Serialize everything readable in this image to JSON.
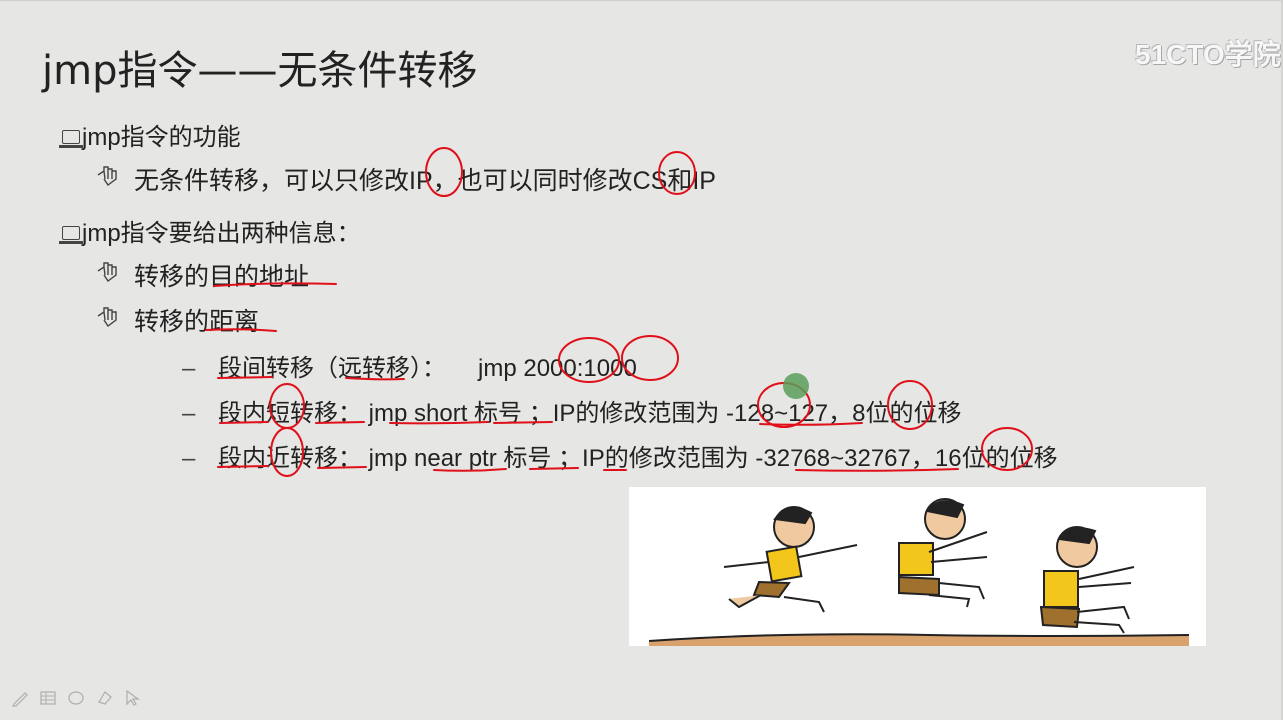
{
  "watermark": "51CTO学院",
  "title": "jmp指令——无条件转移",
  "bullets": {
    "b1": "jmp指令的功能",
    "b1_sub": "无条件转移，可以只修改IP，也可以同时修改CS和IP",
    "b2": "jmp指令要给出两种信息：",
    "b2_sub1": "转移的目的地址",
    "b2_sub2": "转移的距离",
    "d1_label": "段间转移（远转移）：",
    "d1_code": "jmp 2000:1000",
    "d2": "段内短转移： jmp short 标号 ；IP的修改范围为 -128~127，8位的位移",
    "d3": "段内近转移： jmp near ptr 标号  ；IP的修改范围为 -32768~32767，16位的位移"
  },
  "dash_char": "–",
  "toolbar": [
    "pen-icon",
    "table-icon",
    "oval-icon",
    "eraser-icon",
    "pointer-icon"
  ],
  "colors": {
    "annotation": "#e0101a",
    "background": "#e6e6e4",
    "dot": "#5a9e5a"
  }
}
